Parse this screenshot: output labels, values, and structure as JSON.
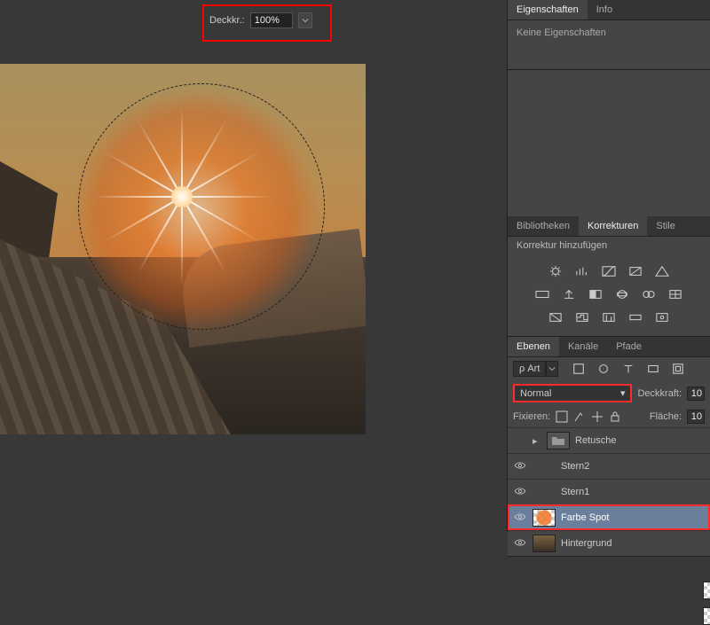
{
  "topbar": {
    "opacity_label": "Deckkr.:",
    "opacity_value": "100%"
  },
  "properties": {
    "tabs": [
      "Eigenschaften",
      "Info"
    ],
    "active_tab": 0,
    "body_text": "Keine Eigenschaften"
  },
  "corrections": {
    "tabs": [
      "Bibliotheken",
      "Korrekturen",
      "Stile"
    ],
    "active_tab": 1,
    "title": "Korrektur hinzufügen"
  },
  "layers_panel": {
    "tabs": [
      "Ebenen",
      "Kanäle",
      "Pfade"
    ],
    "active_tab": 0,
    "kind_label": "ρ Art",
    "blend_mode": "Normal",
    "opacity_label": "Deckkraft:",
    "opacity_value": "10",
    "lock_label": "Fixieren:",
    "fill_label": "Fläche:",
    "fill_value": "10",
    "layers": [
      {
        "name": "Retusche",
        "type": "folder",
        "visible": false,
        "collapsed": true
      },
      {
        "name": "Stern2",
        "type": "star",
        "visible": true
      },
      {
        "name": "Stern1",
        "type": "star",
        "visible": true
      },
      {
        "name": "Farbe Spot",
        "type": "orange",
        "visible": true,
        "selected": true,
        "highlight": true
      },
      {
        "name": "Hintergrund",
        "type": "bg",
        "visible": true
      }
    ]
  }
}
